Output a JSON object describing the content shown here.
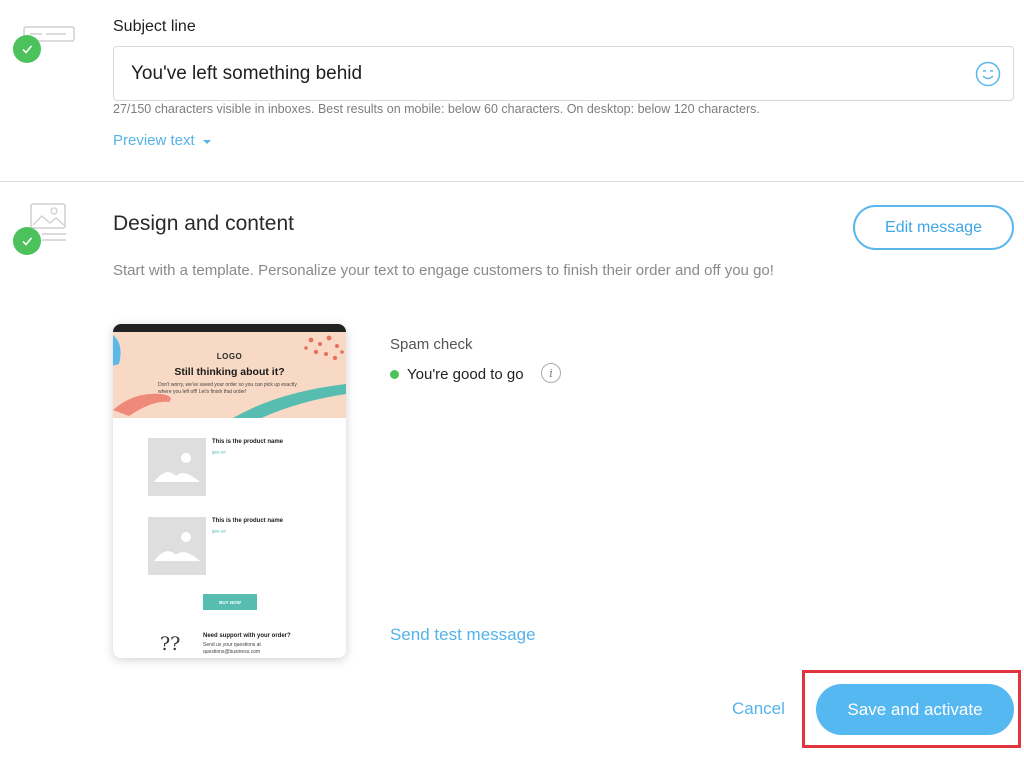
{
  "subject": {
    "label": "Subject line",
    "value": "You've left something behid",
    "hint": "27/150 characters visible in inboxes. Best results on mobile: below 60 characters. On desktop: below 120 characters.",
    "preview_text_label": "Preview text",
    "status": "complete"
  },
  "design": {
    "title": "Design and content",
    "edit_button": "Edit message",
    "description": "Start with a template. Personalize your text to engage customers to finish their order and off you go!",
    "status": "complete"
  },
  "email_preview": {
    "logo": "LOGO",
    "headline": "Still thinking about it?",
    "body": "Don't worry, we've saved your order so you can pick up exactly where you left off! Let's finish that order!",
    "products": [
      {
        "name": "This is the product name",
        "price": "$##.##"
      },
      {
        "name": "This is the product name",
        "price": "$##.##"
      }
    ],
    "buy_button": "BUY NOW",
    "support_title": "Need support with your order?",
    "support_body": "Send us your questions at questions@business.com",
    "colors": {
      "hero": "#f8d9c5",
      "accent": "#56bdb0"
    }
  },
  "spam_check": {
    "label": "Spam check",
    "status": "You're good to go",
    "status_color": "#4cc25c"
  },
  "actions": {
    "send_test": "Send test message",
    "cancel": "Cancel",
    "save": "Save and activate"
  },
  "colors": {
    "link": "#55b3e8",
    "primary": "#55b8f0",
    "success": "#4cc25c",
    "highlight": "#e0353f"
  }
}
